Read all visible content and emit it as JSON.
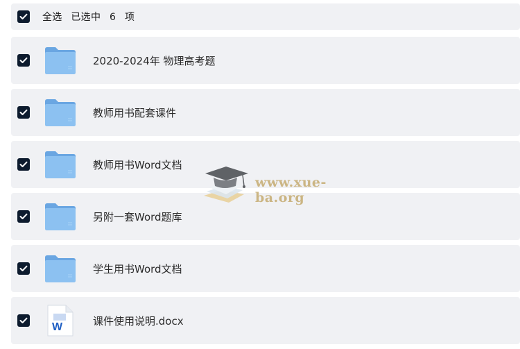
{
  "header": {
    "select_all_label": "全选",
    "selected_label": "已选中",
    "selected_count": "6",
    "unit_label": "项"
  },
  "files": [
    {
      "name": "2020-2024年 物理高考题",
      "type": "folder",
      "checked": true
    },
    {
      "name": "教师用书配套课件",
      "type": "folder",
      "checked": true
    },
    {
      "name": "教师用书Word文档",
      "type": "folder",
      "checked": true
    },
    {
      "name": "另附一套Word题库",
      "type": "folder",
      "checked": true
    },
    {
      "name": "学生用书Word文档",
      "type": "folder",
      "checked": true
    },
    {
      "name": "课件使用说明.docx",
      "type": "word-document",
      "checked": true
    }
  ],
  "watermark": {
    "text": "www.xue-ba.org",
    "icon": "graduation-cap-icon"
  },
  "colors": {
    "row_background": "#f0f1f4",
    "checkbox": "#0d1b2e",
    "folder_blue": "#7fb6ea",
    "word_blue": "#1f5fc4"
  }
}
